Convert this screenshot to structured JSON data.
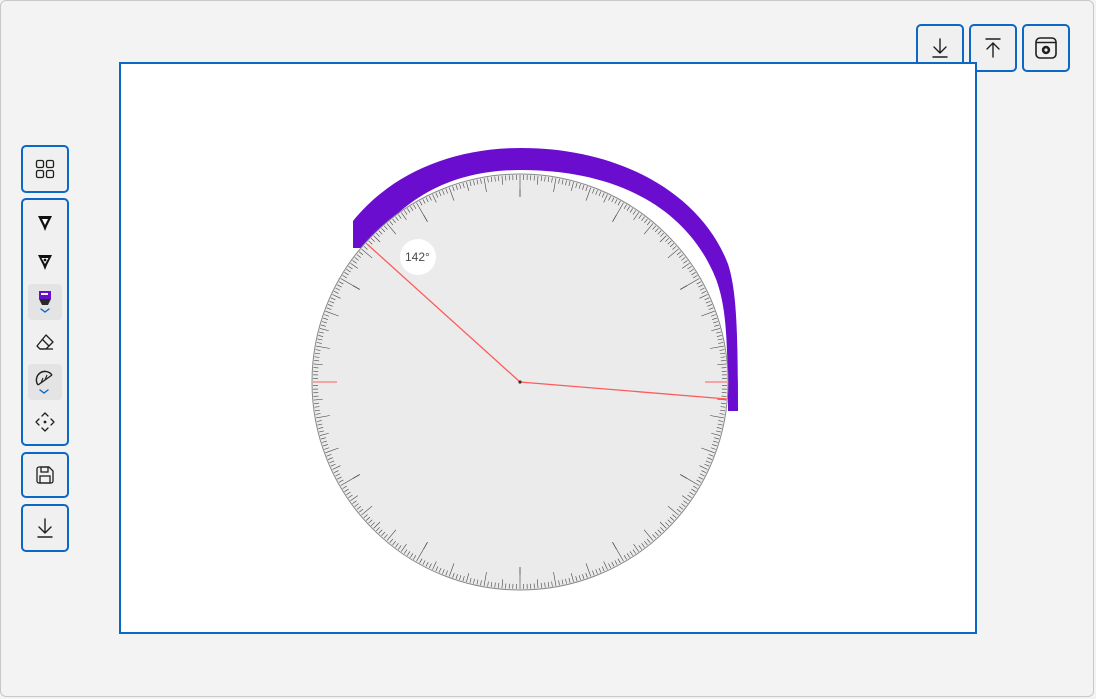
{
  "toolbar_top": {
    "buttons": [
      {
        "name": "download-button",
        "icon": "arrow-down-to-line-icon"
      },
      {
        "name": "upload-button",
        "icon": "arrow-up-from-line-icon"
      },
      {
        "name": "settings-button",
        "icon": "gear-icon"
      }
    ]
  },
  "toolbar_left": {
    "all_tools_icon": "grid-icon",
    "tools": [
      {
        "name": "ballpoint-pen",
        "icon": "pen-icon"
      },
      {
        "name": "pencil",
        "icon": "pencil-icon"
      },
      {
        "name": "highlighter",
        "icon": "highlighter-icon",
        "selected": true,
        "color": "#6a0dcf"
      },
      {
        "name": "eraser",
        "icon": "eraser-icon"
      },
      {
        "name": "ruler",
        "icon": "ruler-icon",
        "selected": true
      },
      {
        "name": "pan",
        "icon": "move-icon"
      }
    ],
    "save_icon": "save-icon",
    "download_icon": "arrow-down-to-line-icon"
  },
  "protractor": {
    "angle_label": "142°",
    "angle_degrees": 142
  },
  "colors": {
    "accent": "#0b68c4",
    "ink": "#6a0dcf",
    "protractor_line": "#ff5b5b",
    "protractor_face": "#ebebeb"
  }
}
